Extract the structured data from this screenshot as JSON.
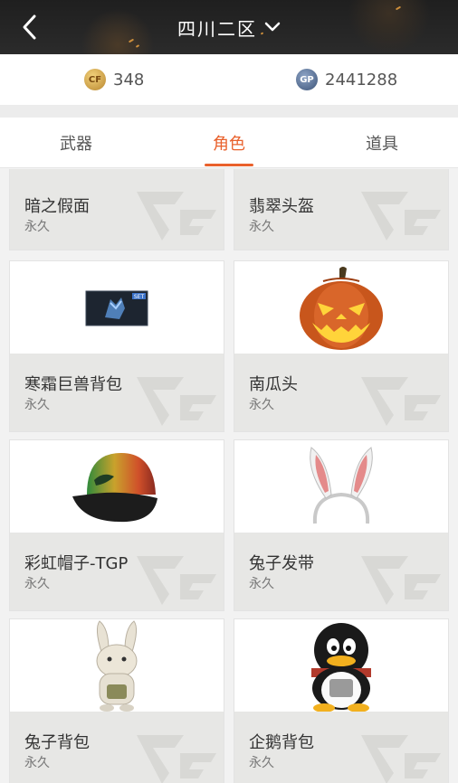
{
  "header": {
    "server_name": "四川二区"
  },
  "balance": {
    "cf_points": "348",
    "gp_points": "2441288"
  },
  "tabs": [
    {
      "label": "武器",
      "active": false
    },
    {
      "label": "角色",
      "active": true
    },
    {
      "label": "道具",
      "active": false
    }
  ],
  "items": [
    {
      "name": "暗之假面",
      "duration": "永久",
      "icon": "mask-icon"
    },
    {
      "name": "翡翠头盔",
      "duration": "永久",
      "icon": "helmet-icon"
    },
    {
      "name": "寒霜巨兽背包",
      "duration": "永久",
      "icon": "frost-beast-backpack-icon"
    },
    {
      "name": "南瓜头",
      "duration": "永久",
      "icon": "pumpkin-head-icon"
    },
    {
      "name": "彩虹帽子-TGP",
      "duration": "永久",
      "icon": "rainbow-cap-icon"
    },
    {
      "name": "兔子发带",
      "duration": "永久",
      "icon": "bunny-headband-icon"
    },
    {
      "name": "兔子背包",
      "duration": "永久",
      "icon": "bunny-backpack-icon"
    },
    {
      "name": "企鹅背包",
      "duration": "永久",
      "icon": "penguin-backpack-icon"
    }
  ],
  "thumb_badge": "SET",
  "colors": {
    "accent": "#e9612c",
    "header_bg": "#222222",
    "card_info_bg": "#e7e7e5"
  }
}
